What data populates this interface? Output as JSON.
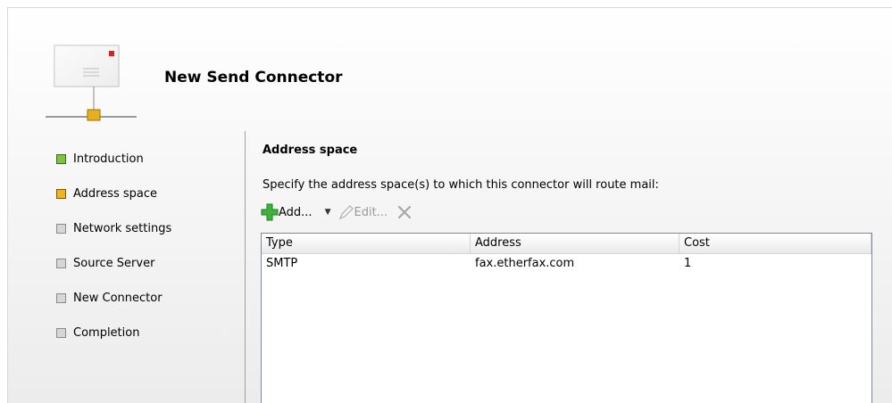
{
  "wizard": {
    "title": "New Send Connector",
    "icon": "send-connector-icon"
  },
  "steps": [
    {
      "label": "Introduction",
      "state": "done"
    },
    {
      "label": "Address space",
      "state": "current"
    },
    {
      "label": "Network settings",
      "state": "pending"
    },
    {
      "label": "Source Server",
      "state": "pending"
    },
    {
      "label": "New Connector",
      "state": "pending"
    },
    {
      "label": "Completion",
      "state": "pending"
    }
  ],
  "page": {
    "section_title": "Address space",
    "description": "Specify the address space(s) to which this connector will route mail:"
  },
  "toolbar": {
    "add_label": "Add...",
    "edit_label": "Edit...",
    "add_icon": "plus-icon",
    "edit_icon": "pencil-icon",
    "remove_icon": "remove-x-icon",
    "dropdown_icon": "chevron-down-icon"
  },
  "table": {
    "columns": [
      "Type",
      "Address",
      "Cost"
    ],
    "rows": [
      [
        "SMTP",
        "fax.etherfax.com",
        "1"
      ]
    ]
  },
  "colors": {
    "done_marker": "#7cc441",
    "current_marker": "#f2b418",
    "pending_marker": "#d6d6d6",
    "add_icon": "#3cb43c"
  }
}
